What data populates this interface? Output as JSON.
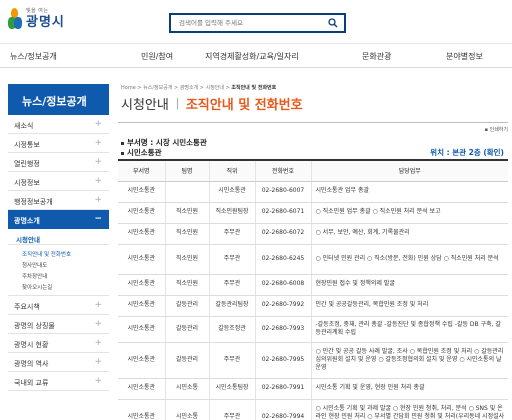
{
  "header": {
    "logo_sub": "빛을 여는",
    "logo_main": "광명시",
    "search_placeholder": "검색어를 입력해 주세요"
  },
  "gnb": [
    "뉴스/정보공개",
    "민원/참여",
    "지역경제활성화/교육/일자리",
    "문화관광",
    "분야별정보"
  ],
  "sidebar": {
    "title": "뉴스/정보공개",
    "items": [
      {
        "label": "새소식",
        "icon": "+"
      },
      {
        "label": "시정통보",
        "icon": "+"
      },
      {
        "label": "열린행정",
        "icon": "+"
      },
      {
        "label": "시정정보",
        "icon": "+"
      },
      {
        "label": "행정정보공개",
        "icon": "+"
      }
    ],
    "active": {
      "label": "광명소개",
      "icon": "−"
    },
    "sub_active": "시청안내",
    "sub_sub": [
      "조직안내 및 전화번호",
      "청사안내도",
      "주차장안내",
      "찾아오시는길"
    ],
    "items_after": [
      {
        "label": "주요시책",
        "icon": "+"
      },
      {
        "label": "광명의 상징물",
        "icon": "+"
      },
      {
        "label": "광명시 현황",
        "icon": "+"
      },
      {
        "label": "광명의 역사",
        "icon": "+"
      },
      {
        "label": "국내외 교류",
        "icon": "+"
      }
    ]
  },
  "content": {
    "breadcrumb": [
      "Home",
      "뉴스/정보공개",
      "광명소개",
      "시청안내",
      "조직안내 및 전화번호"
    ],
    "title_1": "시청안내",
    "title_2": "조직안내 및 전화번호",
    "print": "인쇄하기",
    "section_1": "부서명 : 시장   시민소통관",
    "section_2": "시민소통관",
    "location": "위치 : 본관 2층 (확인)"
  },
  "table": {
    "headers": [
      "부서명",
      "팀명",
      "직위",
      "전화번호",
      "담당업무"
    ],
    "rows": [
      [
        "시민소통관",
        "",
        "시민소통관",
        "02-2680-6007",
        "시민소통관 업무 총괄"
      ],
      [
        "시민소통관",
        "직소민원",
        "직소민원팀장",
        "02-2680-6071",
        "○ 직소민원 업무 총괄  ○ 직소민원 처리 분석 보고"
      ],
      [
        "시민소통관",
        "직소민원",
        "주무관",
        "02-2680-6072",
        "○ 서무, 보안, 예산, 회계, 기록물관리"
      ],
      [
        "시민소통관",
        "직소민원",
        "주무관",
        "02-2680-6245",
        "○ 인터넷 민원 관리  ○ 직소(방문, 전화) 민원 상담  ○ 직소민원 처리 분석"
      ],
      [
        "시민소통관",
        "직소민원",
        "주무관",
        "02-2680-6008",
        "현장민원 접수 및 정책의제 발굴"
      ],
      [
        "시민소통관",
        "갈등관리",
        "갈등관리팀장",
        "02-2680-7992",
        "민간 및 공공갈등관리, 복합민원 조정 및 처리"
      ],
      [
        "시민소통관",
        "갈등관리",
        "갈등조정관",
        "02-2680-7993",
        "-갈등조정, 중재, 관리 총괄 -갈등진단 및 종합정책 수립 -갈등 DB 구축, 갈등관리계획 수립"
      ],
      [
        "시민소통관",
        "갈등관리",
        "주무관",
        "02-2680-7995",
        "○ 민간 및 공공 갈등 사례 발굴, 조사  ○ 복합민원 조정 및 처리  ○ 갈등관리심의위원회 설치 및 운영  ○ 갈등조정협의회 설치 및 운영  ○ 시민소통의 날 운영"
      ],
      [
        "시민소통관",
        "시민소통",
        "시민소통팀장",
        "02-2680-7991",
        "시민소통 기획 및 운영, 현장 민원 처리 총괄"
      ],
      [
        "시민소통관",
        "시민소통",
        "주무관",
        "02-2680-7994",
        "○ 시민소통 기획 및 과제 발굴  ○ 현장 민원 청취, 처리, 분석  ○ SNS 및 온라인 현장 민원 처리  ○ 부서별 간담회 민원 청취 및 처리(우리동네 시정설사리즈바인과 대화 등)  ○ 생생 소통 현장 운영"
      ]
    ]
  }
}
